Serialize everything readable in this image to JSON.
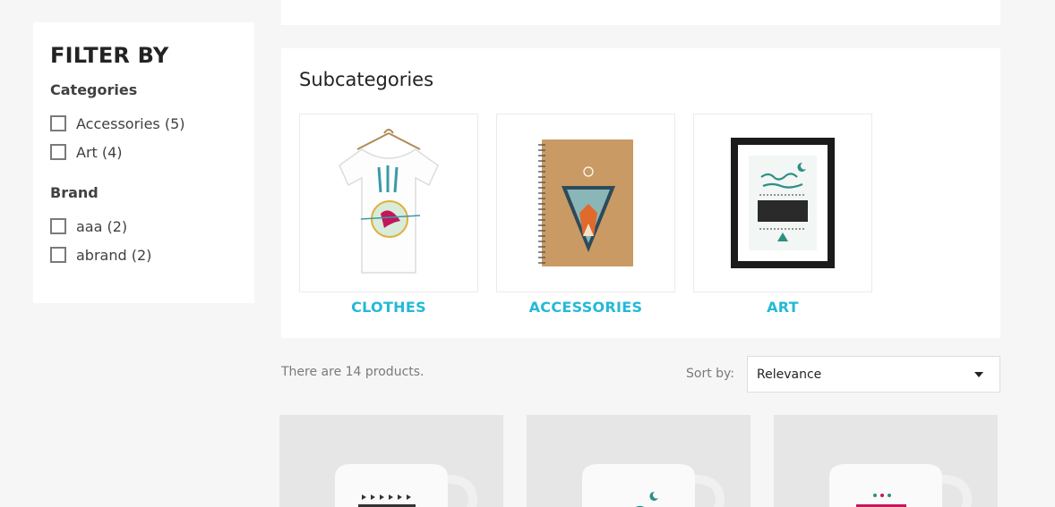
{
  "filters": {
    "title": "FILTER BY",
    "categories": {
      "title": "Categories",
      "items": [
        {
          "label": "Accessories (5)"
        },
        {
          "label": "Art (4)"
        }
      ]
    },
    "brand": {
      "title": "Brand",
      "items": [
        {
          "label": "aaa (2)"
        },
        {
          "label": "abrand (2)"
        }
      ]
    }
  },
  "subcategories": {
    "title": "Subcategories",
    "items": [
      {
        "name": "CLOTHES",
        "icon": "tshirt-icon"
      },
      {
        "name": "ACCESSORIES",
        "icon": "notebook-icon"
      },
      {
        "name": "ART",
        "icon": "framed-poster-icon"
      }
    ]
  },
  "products": {
    "count_text": "There are 14 products.",
    "sort_label": "Sort by:",
    "sort_value": "Relevance"
  },
  "colors": {
    "accent": "#24b9d7"
  }
}
